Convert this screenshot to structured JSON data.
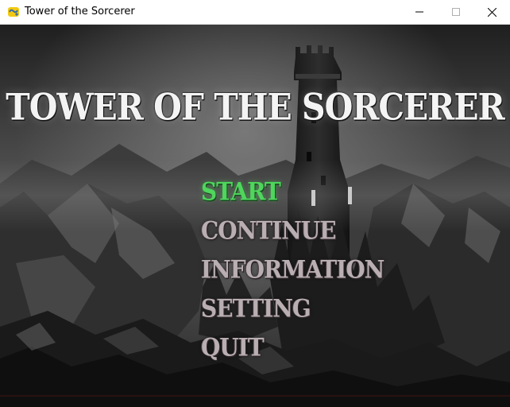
{
  "window": {
    "title": "Tower of the Sorcerer",
    "app_icon": "pygame-snake-icon",
    "controls": {
      "minimize_icon": "minimize-icon",
      "maximize_icon": "maximize-icon",
      "close_icon": "close-icon"
    }
  },
  "game": {
    "title": "TOWER OF THE SORCERER",
    "background": "dark-mountain-tower-scene",
    "menu": {
      "items": [
        {
          "label": "START",
          "selected": true
        },
        {
          "label": "CONTINUE",
          "selected": false
        },
        {
          "label": "INFORMATION",
          "selected": false
        },
        {
          "label": "SETTING",
          "selected": false
        },
        {
          "label": "QUIT",
          "selected": false
        }
      ]
    }
  },
  "colors": {
    "selected_item": "#4fd65c",
    "menu_item": "#b9aeb2",
    "title_text": "#f4f4f4"
  }
}
